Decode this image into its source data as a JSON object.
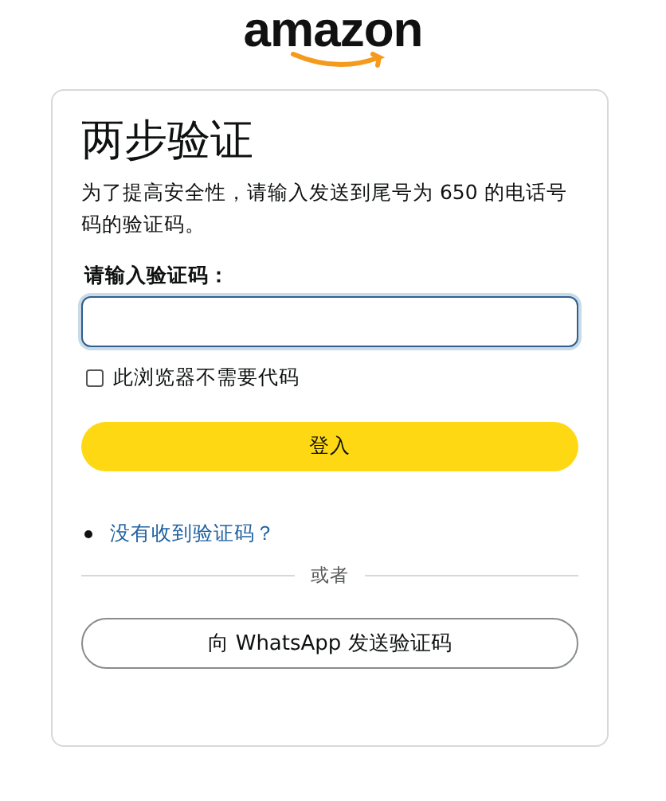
{
  "logo": {
    "text": "amazon"
  },
  "card": {
    "title": "两步验证",
    "description": "为了提高安全性，请输入发送到尾号为 650 的电话号码的验证码。",
    "code_label": "请输入验证码：",
    "code_field": {
      "focused": true
    },
    "remember": {
      "label": "此浏览器不需要代码",
      "checked": false
    },
    "sign_in_button": "登入",
    "help_links": [
      "没有收到验证码？"
    ],
    "divider": "或者",
    "whatsapp_button": "向 WhatsApp 发送验证码"
  }
}
